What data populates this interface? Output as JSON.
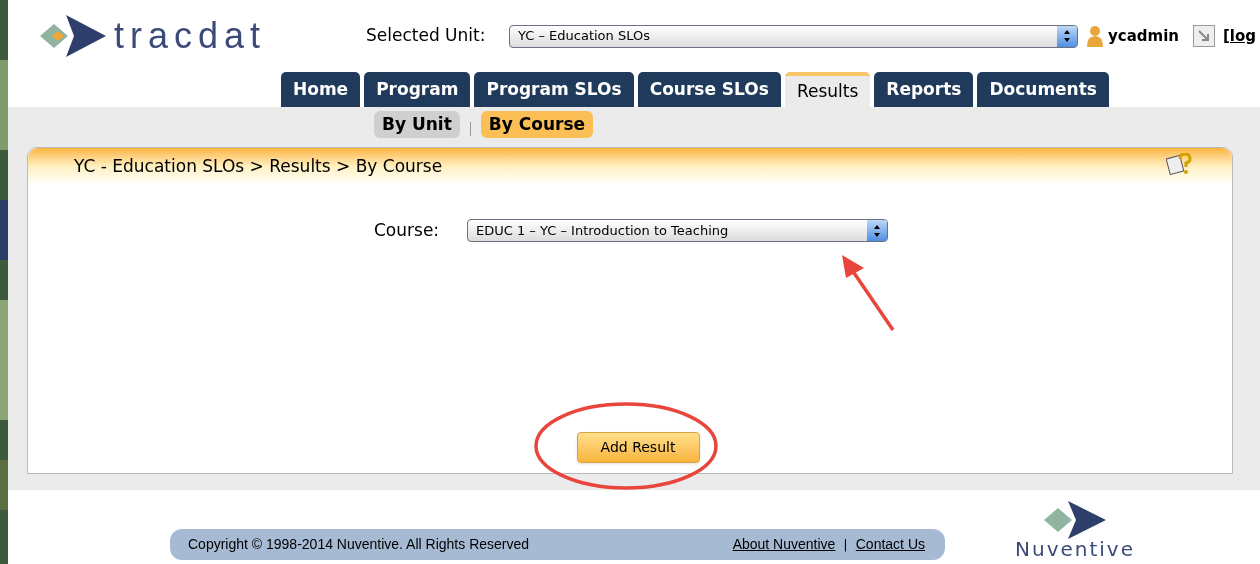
{
  "header": {
    "logo": "tracdat",
    "unit_label": "Selected Unit:",
    "unit_value": "YC – Education SLOs",
    "user": "ycadmin",
    "logout": "[log"
  },
  "tabs": [
    {
      "label": "Home",
      "selected": false
    },
    {
      "label": "Program",
      "selected": false
    },
    {
      "label": "Program SLOs",
      "selected": false
    },
    {
      "label": "Course SLOs",
      "selected": false
    },
    {
      "label": "Results",
      "selected": true
    },
    {
      "label": "Reports",
      "selected": false
    },
    {
      "label": "Documents",
      "selected": false
    }
  ],
  "subtabs": [
    {
      "label": "By Unit",
      "selected": false
    },
    {
      "label": "By Course",
      "selected": true
    }
  ],
  "panel": {
    "breadcrumb": "YC - Education SLOs > Results > By Course",
    "course_label": "Course:",
    "course_value": "EDUC 1 – YC – Introduction to Teaching",
    "button": "Add Result"
  },
  "footer": {
    "copyright": "Copyright © 1998-2014 Nuventive. All Rights Reserved",
    "links": [
      "About Nuventive",
      "Contact Us"
    ],
    "separator": "|",
    "logo": "Nuventive"
  }
}
